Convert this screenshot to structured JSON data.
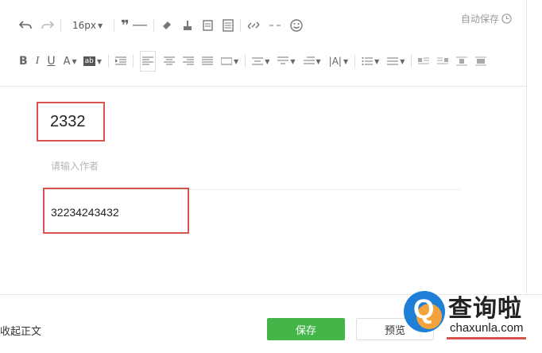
{
  "toolbar": {
    "font_size": "16px",
    "autosave_label": "自动保存"
  },
  "editor": {
    "title_value": "2332",
    "author_placeholder": "请输入作者",
    "body_value": "32234243432"
  },
  "footer": {
    "collapse_label": "收起正文",
    "save_label": "保存",
    "preview_label": "预览"
  },
  "watermark": {
    "brand_cn": "查询啦",
    "brand_url": "chaxunla.com"
  },
  "colors": {
    "accent_green": "#44b549",
    "highlight_red": "#d9534f",
    "watermark_blue": "#1f7fd6",
    "watermark_orange": "#f3a33b"
  }
}
